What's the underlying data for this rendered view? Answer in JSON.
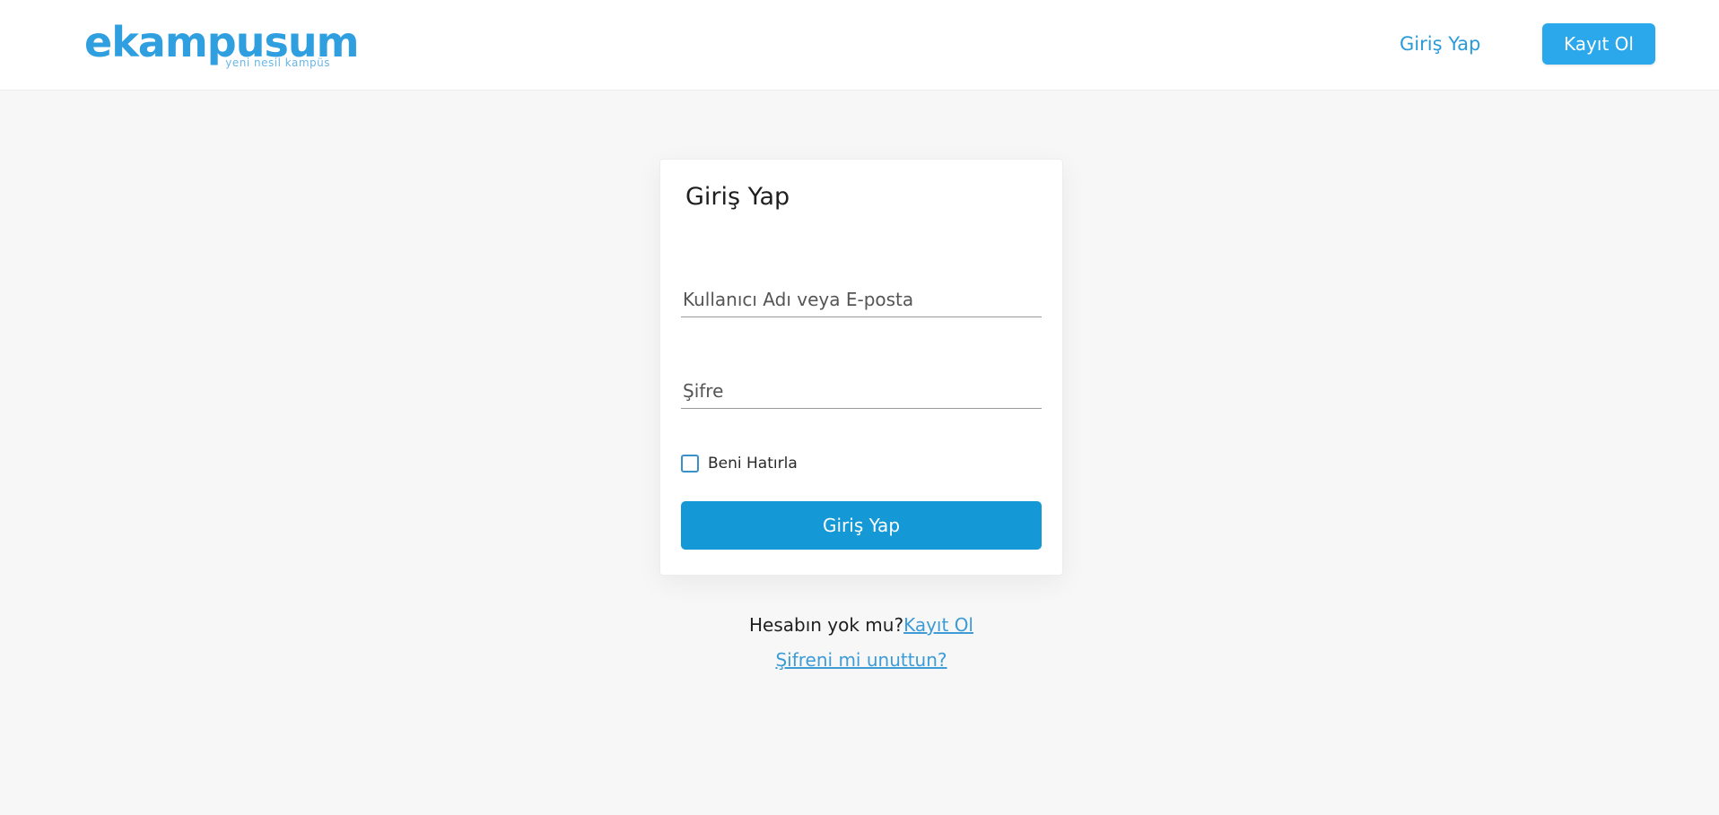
{
  "header": {
    "logo_text": "ekampusum",
    "logo_tagline": "yeni nesil kampüs",
    "login_link": "Giriş Yap",
    "register_button": "Kayıt Ol"
  },
  "login_card": {
    "title": "Giriş Yap",
    "username_placeholder": "Kullanıcı Adı veya E-posta",
    "username_value": "",
    "password_placeholder": "Şifre",
    "password_value": "",
    "remember_label": "Beni Hatırla",
    "remember_checked": false,
    "submit_label": "Giriş Yap"
  },
  "footer": {
    "no_account_text": "Hesabın yok mu?",
    "register_link": "Kayıt Ol",
    "forgot_password_link": "Şifreni mi unuttun?"
  },
  "colors": {
    "brand": "#2f9fe0",
    "primary_button": "#1599d6",
    "nav_button": "#2ba8ec",
    "page_background": "#f7f7f7"
  }
}
